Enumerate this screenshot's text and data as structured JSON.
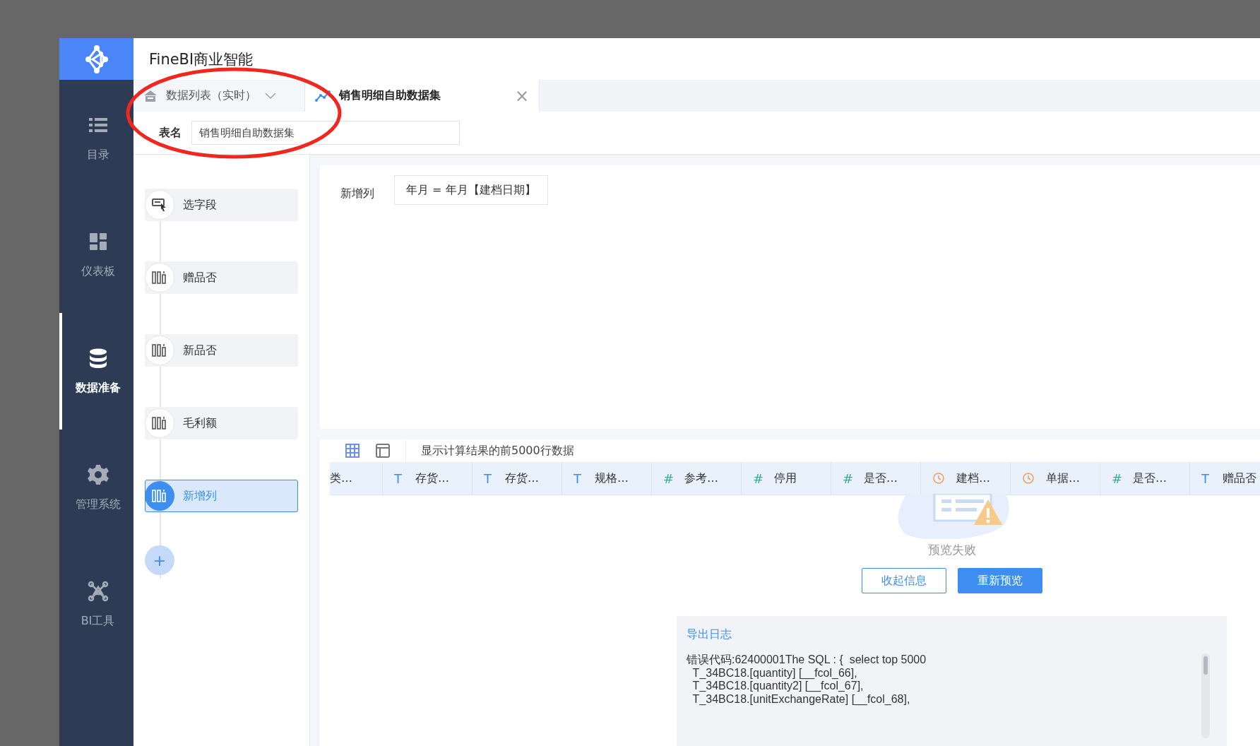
{
  "app": {
    "title": "FineBI商业智能"
  },
  "sidebar": {
    "items": [
      {
        "kind": "list",
        "label": "目录",
        "selected": false
      },
      {
        "kind": "dashboard",
        "label": "仪表板",
        "selected": false
      },
      {
        "kind": "database",
        "label": "数据准备",
        "selected": true
      },
      {
        "kind": "settings",
        "label": "管理系统",
        "selected": false
      },
      {
        "kind": "tools",
        "label": "BI工具",
        "selected": false
      }
    ]
  },
  "tabs": [
    {
      "kind": "home",
      "label": "数据列表（实时）",
      "selected": false
    },
    {
      "kind": "dataset",
      "label": "销售明细自助数据集",
      "selected": true,
      "close": "×"
    }
  ],
  "table_name": {
    "label": "表名",
    "value": "销售明细自助数据集"
  },
  "steps": [
    {
      "kind": "select",
      "label": "选字段",
      "selected": false
    },
    {
      "kind": "column",
      "label": "赠品否",
      "selected": false
    },
    {
      "kind": "column",
      "label": "新品否",
      "selected": false
    },
    {
      "kind": "column",
      "label": "毛利额",
      "selected": false
    },
    {
      "kind": "column",
      "label": "新增列",
      "selected": true
    }
  ],
  "add_step": "+",
  "formula": {
    "label": "新增列",
    "value": "年月 = 年月【建档日期】"
  },
  "preview": {
    "views": [
      {
        "kind": "grid",
        "selected": true
      },
      {
        "kind": "layout",
        "selected": false
      }
    ],
    "note": "显示计算结果的前5000行数据",
    "columns": [
      {
        "label": "类…"
      },
      {
        "kind": "text",
        "glyph": "T",
        "label": "存货…"
      },
      {
        "kind": "text",
        "glyph": "T",
        "label": "存货…"
      },
      {
        "kind": "text",
        "glyph": "T",
        "label": "规格…"
      },
      {
        "kind": "number",
        "glyph": "#",
        "label": "参考…"
      },
      {
        "kind": "number",
        "glyph": "#",
        "label": "停用"
      },
      {
        "kind": "number",
        "glyph": "#",
        "label": "是否…"
      },
      {
        "kind": "date",
        "label": "建档…"
      },
      {
        "kind": "date",
        "label": "单据…"
      },
      {
        "kind": "number",
        "glyph": "#",
        "label": "是否…"
      },
      {
        "kind": "text",
        "glyph": "T",
        "label": "赠品否"
      }
    ],
    "error": {
      "message": "预览失败",
      "buttons": [
        {
          "kind": "secondary",
          "label": "收起信息"
        },
        {
          "kind": "primary",
          "label": "重新预览"
        }
      ]
    },
    "log": {
      "title": "导出日志",
      "lines": [
        "错误代码:62400001The SQL : {  select top 5000",
        "  T_34BC18.[quantity] [__fcol_66],",
        "  T_34BC18.[quantity2] [__fcol_67],",
        "  T_34BC18.[unitExchangeRate] [__fcol_68],"
      ]
    }
  },
  "annotation": {
    "kind": "ellipse",
    "color": "#f0271f"
  }
}
